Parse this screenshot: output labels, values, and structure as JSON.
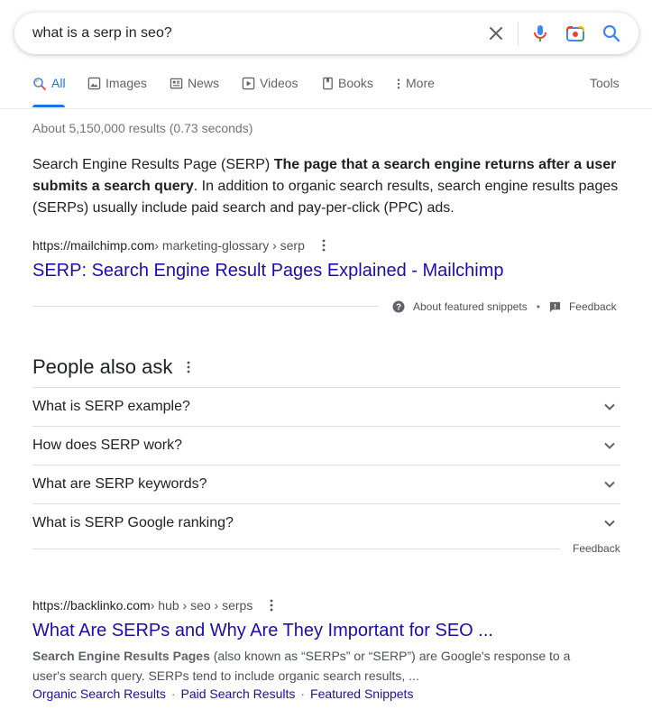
{
  "search": {
    "query": "what is a serp in seo?"
  },
  "tabs": [
    {
      "label": "All",
      "icon": "search-icon"
    },
    {
      "label": "Images",
      "icon": "image-icon"
    },
    {
      "label": "News",
      "icon": "news-icon"
    },
    {
      "label": "Videos",
      "icon": "video-icon"
    },
    {
      "label": "Books",
      "icon": "book-icon"
    },
    {
      "label": "More",
      "icon": "more-vert-icon"
    }
  ],
  "tools_label": "Tools",
  "stats": "About 5,150,000 results (0.73 seconds)",
  "featured_snippet": {
    "text_start": "Search Engine Results Page (SERP) ",
    "text_bold": "The page that a search engine returns after a user submits a search query",
    "text_end": ". In addition to organic search results, search engine results pages (SERPs) usually include paid search and pay-per-click (PPC) ads.",
    "cite_domain": "https://mailchimp.com",
    "cite_path": " › marketing-glossary › serp",
    "title": "SERP: Search Engine Result Pages Explained - Mailchimp",
    "about_label": "About featured snippets",
    "feedback_label": "Feedback"
  },
  "people_also_ask": {
    "title": "People also ask",
    "questions": [
      "What is SERP example?",
      "How does SERP work?",
      "What are SERP keywords?",
      "What is SERP Google ranking?"
    ],
    "feedback_label": "Feedback"
  },
  "result": {
    "cite_domain": "https://backlinko.com",
    "cite_path": " › hub › seo › serps",
    "title": "What Are SERPs and Why Are They Important for SEO ...",
    "desc_bold": "Search Engine Results Pages",
    "desc_rest": " (also known as “SERPs” or “SERP”) are Google's response to a user's search query. SERPs tend to include organic search results, ...",
    "sitelinks": [
      "Organic Search Results",
      "Paid Search Results",
      "Featured Snippets"
    ]
  },
  "colors": {
    "link": "#1a0dab",
    "accent": "#1a73e8",
    "mic_blue": "#4285f4",
    "mic_red": "#ea4335"
  }
}
